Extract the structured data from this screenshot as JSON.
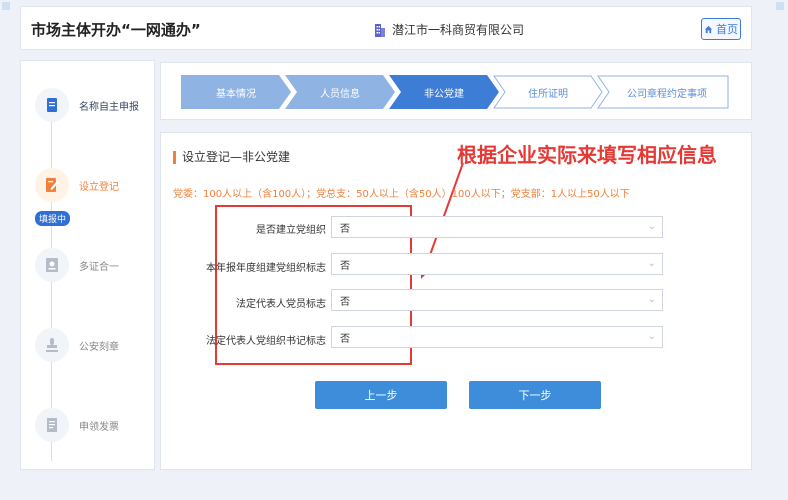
{
  "header": {
    "app_title": "市场主体开办“一网通办”",
    "company_name": "潜江市一科商贸有限公司",
    "home_label": "首页",
    "icons": [
      "building-icon",
      "home-icon"
    ]
  },
  "sidebar": {
    "items": [
      {
        "label": "名称自主申报",
        "state": "done",
        "icon": "document-icon"
      },
      {
        "label": "设立登记",
        "state": "active",
        "icon": "edit-document-icon"
      },
      {
        "label": "多证合一",
        "state": "pending",
        "icon": "id-card-icon"
      },
      {
        "label": "公安刻章",
        "state": "pending",
        "icon": "stamp-icon"
      },
      {
        "label": "申领发票",
        "state": "pending",
        "icon": "invoice-icon"
      }
    ],
    "badge": "填报中"
  },
  "steps": [
    {
      "label": "基本情况",
      "state": "done"
    },
    {
      "label": "人员信息",
      "state": "done"
    },
    {
      "label": "非公党建",
      "state": "current"
    },
    {
      "label": "住所证明",
      "state": "todo"
    },
    {
      "label": "公司章程约定事项",
      "state": "todo"
    }
  ],
  "main": {
    "section_title": "设立登记—非公党建",
    "note": "党委：100人以上（含100人）；党总支：50人以上（含50人）100人以下；党支部：1人以上50人以下",
    "annotation": "根据企业实际来填写相应信息",
    "fields": [
      {
        "label": "是否建立党组织",
        "value": "否"
      },
      {
        "label": "本年报年度组建党组织标志",
        "value": "否"
      },
      {
        "label": "法定代表人党员标志",
        "value": "否"
      },
      {
        "label": "法定代表人党组织书记标志",
        "value": "否"
      }
    ],
    "prev_label": "上一步",
    "next_label": "下一步"
  },
  "colors": {
    "primary": "#3e8ddb",
    "accent_orange": "#f0803c",
    "annotation_red": "#e53935",
    "step_done": "#8fb3e3",
    "step_current": "#3d7dd6"
  }
}
